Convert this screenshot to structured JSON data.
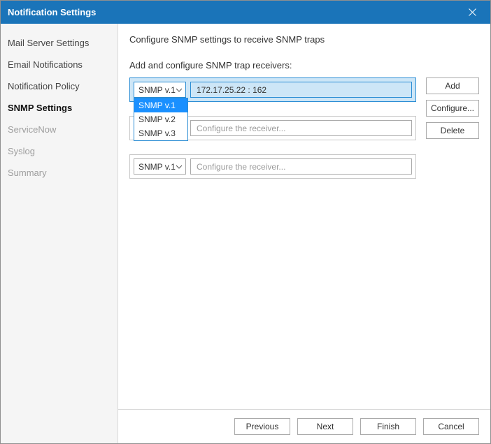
{
  "titlebar": {
    "title": "Notification Settings"
  },
  "sidebar": {
    "items": [
      {
        "label": "Mail Server Settings",
        "state": "normal"
      },
      {
        "label": "Email Notifications",
        "state": "normal"
      },
      {
        "label": "Notification Policy",
        "state": "normal"
      },
      {
        "label": "SNMP Settings",
        "state": "selected"
      },
      {
        "label": "ServiceNow",
        "state": "disabled"
      },
      {
        "label": "Syslog",
        "state": "disabled"
      },
      {
        "label": "Summary",
        "state": "disabled"
      }
    ]
  },
  "content": {
    "heading": "Configure SNMP settings to receive SNMP traps",
    "subheading": "Add and configure SNMP trap receivers:",
    "placeholder": "Configure the receiver...",
    "rows": [
      {
        "version": "SNMP v.1",
        "receiver": "172.17.25.22 : 162",
        "selected": true,
        "dropdown_open": true
      },
      {
        "version": "SNMP v.1",
        "receiver": "",
        "selected": false,
        "dropdown_open": false
      },
      {
        "version": "SNMP v.1",
        "receiver": "",
        "selected": false,
        "dropdown_open": false
      }
    ],
    "dropdown_options": [
      "SNMP v.1",
      "SNMP v.2",
      "SNMP v.3"
    ],
    "dropdown_highlight": "SNMP v.1"
  },
  "buttons": {
    "add": "Add",
    "configure": "Configure...",
    "delete": "Delete"
  },
  "footer": {
    "previous": "Previous",
    "next": "Next",
    "finish": "Finish",
    "cancel": "Cancel"
  }
}
